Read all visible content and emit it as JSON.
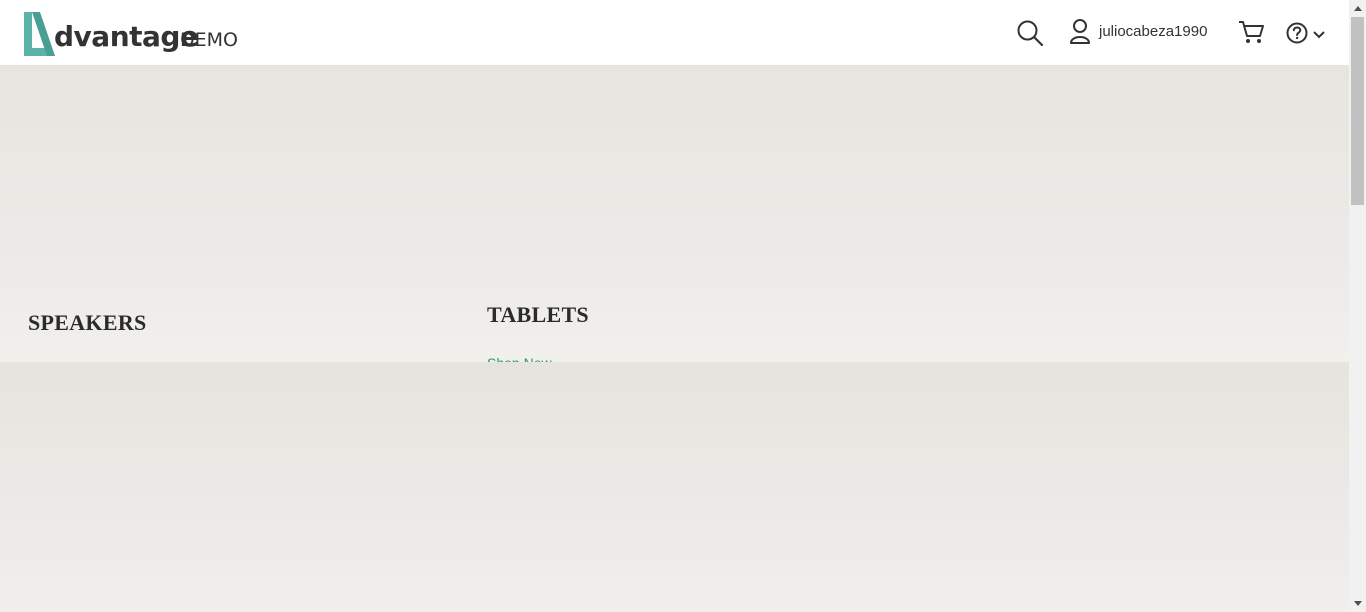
{
  "header": {
    "logo_word": "dvantage",
    "logo_suffix": "DEMO",
    "username": "juliocabeza1990",
    "icons": [
      "search-icon",
      "user-icon",
      "cart-icon",
      "help-icon",
      "chevron-down-icon"
    ]
  },
  "categories": {
    "speakers": {
      "title": "SPEAKERS"
    },
    "tablets": {
      "title": "TABLETS",
      "link": "Shop Now"
    }
  },
  "colors": {
    "brand_teal": "#5bb3a8",
    "link_green": "#2c9a6e",
    "text_dark": "#333333",
    "band_bg": "#e8e6e1"
  }
}
